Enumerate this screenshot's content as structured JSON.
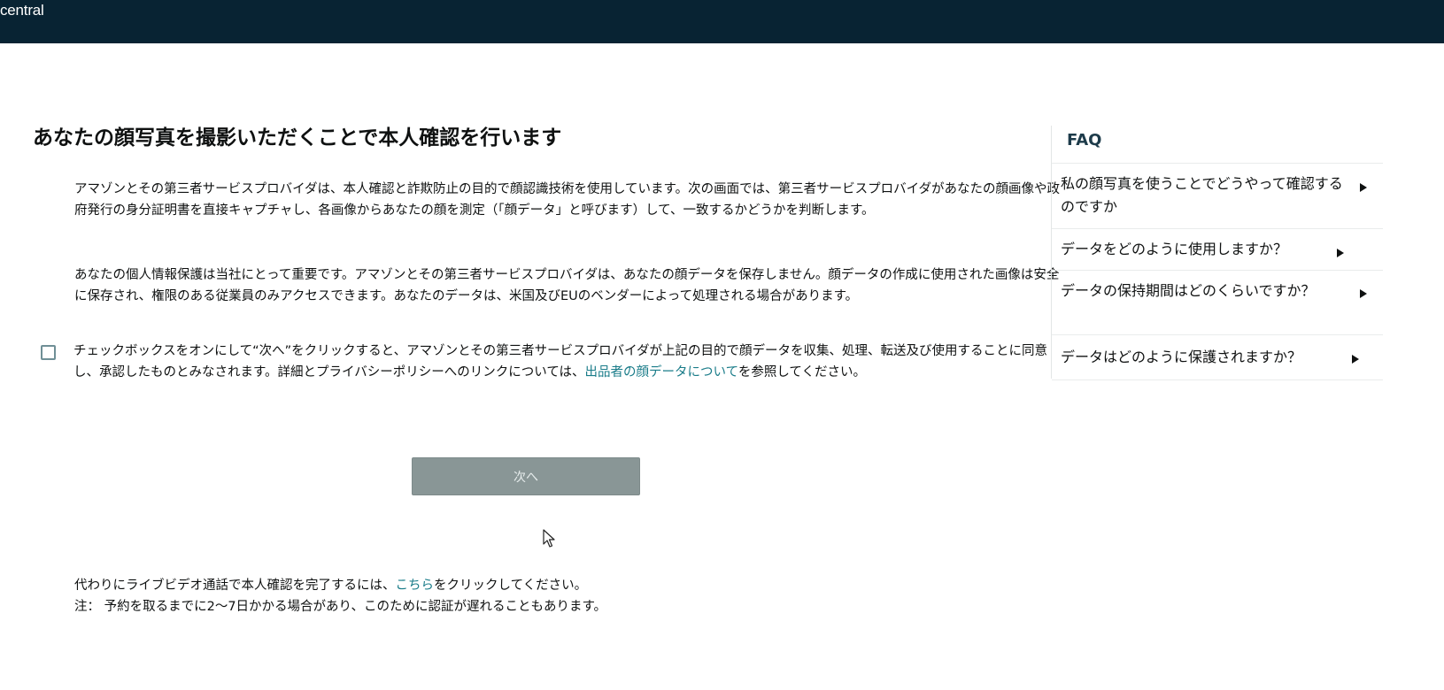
{
  "header": {
    "logo_text": "central"
  },
  "main": {
    "title": "あなたの顔写真を撮影いただくことで本人確認を行います",
    "paragraph1": "アマゾンとその第三者サービスプロバイダは、本人確認と詐欺防止の目的で顔認識技術を使用しています。次の画面では、第三者サービスプロバイダがあなたの顔画像や政府発行の身分証明書を直接キャプチャし、各画像からあなたの顔を測定（「顔データ」と呼びます）して、一致するかどうかを判断します。",
    "paragraph2": "あなたの個人情報保護は当社にとって重要です。アマゾンとその第三者サービスプロバイダは、あなたの顔データを保存しません。顔データの作成に使用された画像は安全に保存され、権限のある従業員のみアクセスできます。あなたのデータは、米国及びEUのベンダーによって処理される場合があります。",
    "consent": {
      "checked": false,
      "text_before": "チェックボックスをオンにして“次へ”をクリックすると、アマゾンとその第三者サービスプロバイダが上記の目的で顔データを収集、処理、転送及び使用することに同意し、承認したものとみなされます。詳細とプライバシーポリシーへのリンクについては、",
      "link_text": "出品者の顔データについて",
      "text_after": "を参照してください。"
    },
    "next_button_label": "次へ",
    "footer": {
      "line1_before": "代わりにライブビデオ通話で本人確認を完了するには、",
      "line1_link": "こちら",
      "line1_after": "をクリックしてください。",
      "line2": "注： 予約を取るまでに2〜7日かかる場合があり、このために認証が遅れることもあります。"
    }
  },
  "faq": {
    "title": "FAQ",
    "items": [
      {
        "label": "私の顔写真を使うことでどうやって確認するのですか"
      },
      {
        "label": "データをどのように使用しますか？"
      },
      {
        "label": "データの保持期間はどのくらいですか？"
      },
      {
        "label": "データはどのように保護されますか？"
      }
    ]
  },
  "colors": {
    "header_bg": "#082333",
    "link": "#1a7c89",
    "button_disabled_bg": "#899696"
  }
}
